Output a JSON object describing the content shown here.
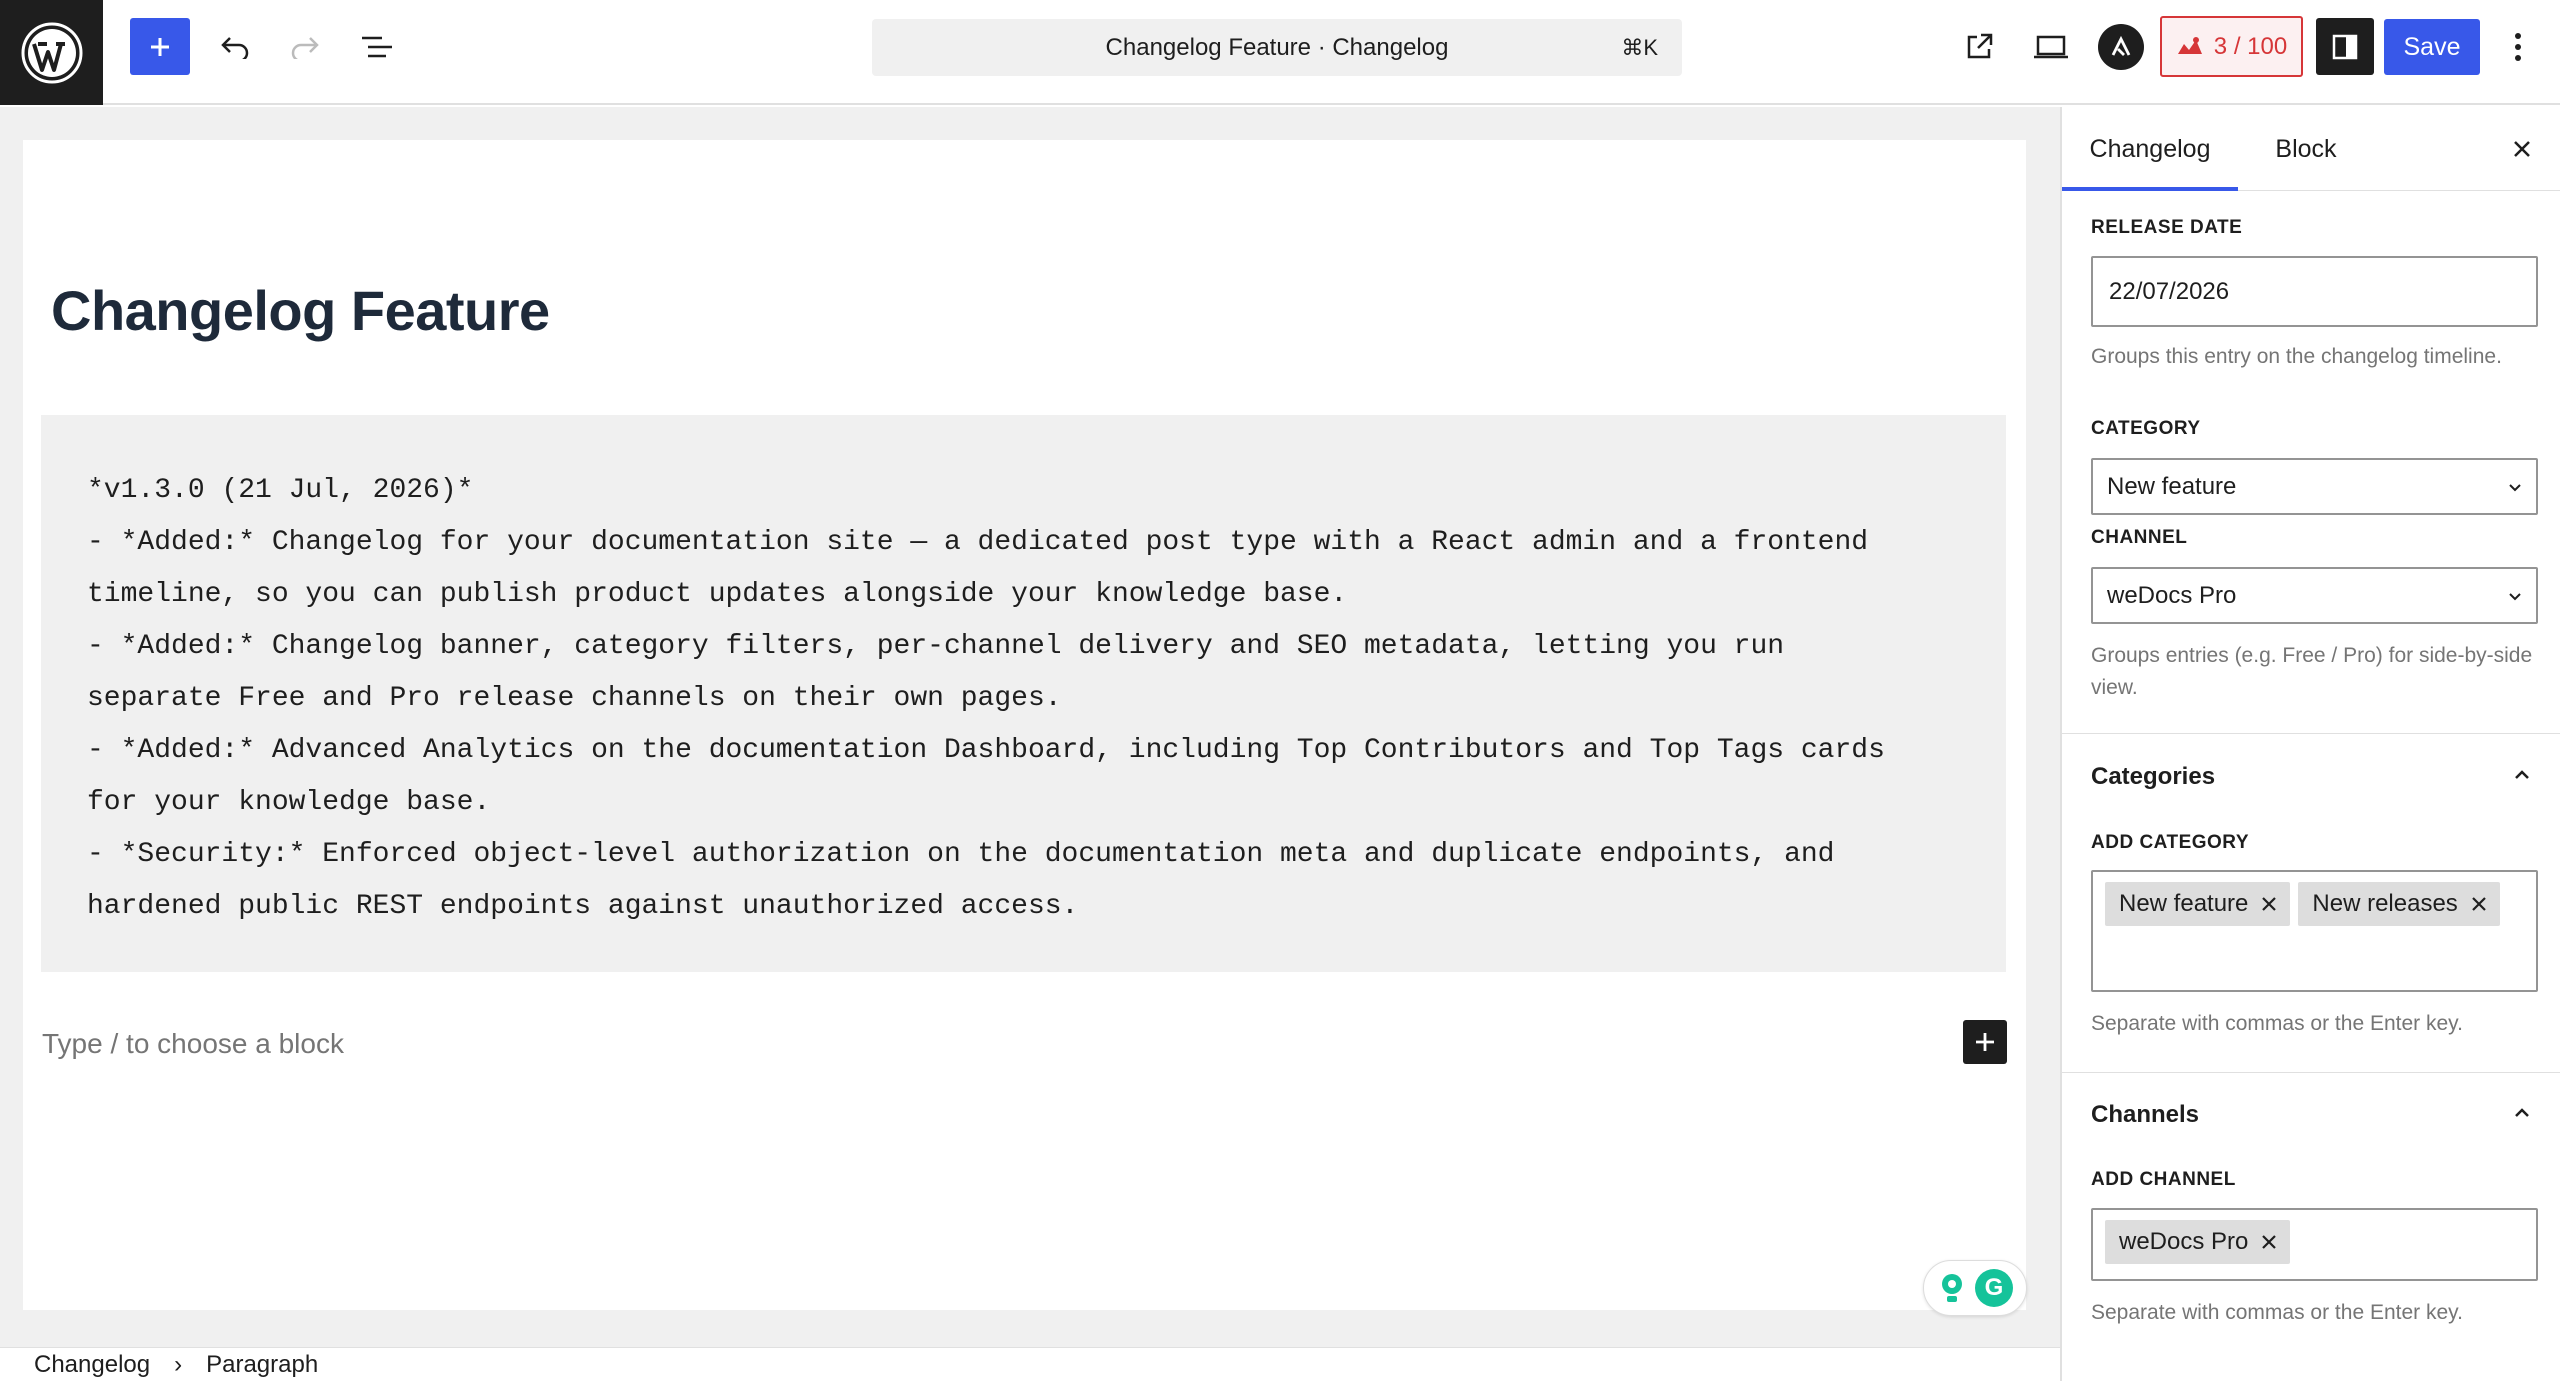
{
  "toolbar": {
    "document_title": "Changelog Feature · Changelog",
    "command_shortcut": "⌘K",
    "score_label": "3 / 100",
    "save_label": "Save"
  },
  "editor": {
    "post_title": "Changelog Feature",
    "code_lines": [
      "*v1.3.0 (21 Jul, 2026)*",
      "- *Added:* Changelog for your documentation site — a dedicated post type with a React admin and a frontend",
      "timeline, so you can publish product updates alongside your knowledge base.",
      "- *Added:* Changelog banner, category filters, per-channel delivery and SEO metadata, letting you run",
      "separate Free and Pro release channels on their own pages.",
      "- *Added:* Advanced Analytics on the documentation Dashboard, including Top Contributors and Top Tags cards",
      "for your knowledge base.",
      "- *Security:* Enforced object-level authorization on the documentation meta and duplicate endpoints, and",
      "hardened public REST endpoints against unauthorized access."
    ],
    "placeholder": "Type / to choose a block"
  },
  "breadcrumb": {
    "items": [
      "Changelog",
      "Paragraph"
    ]
  },
  "sidebar": {
    "tabs": [
      "Changelog",
      "Block"
    ],
    "release_date": {
      "label": "RELEASE DATE",
      "value": "22/07/2026",
      "help": "Groups this entry on the changelog timeline."
    },
    "category": {
      "label": "CATEGORY",
      "value": "New feature"
    },
    "channel": {
      "label": "CHANNEL",
      "value": "weDocs Pro",
      "help": "Groups entries (e.g. Free / Pro) for side-by-side view."
    },
    "categories_panel": {
      "title": "Categories",
      "field_label": "ADD CATEGORY",
      "tokens": [
        "New feature",
        "New releases"
      ],
      "help": "Separate with commas or the Enter key."
    },
    "channels_panel": {
      "title": "Channels",
      "field_label": "ADD CHANNEL",
      "tokens": [
        "weDocs Pro"
      ],
      "help": "Separate with commas or the Enter key."
    }
  },
  "colors": {
    "accent": "#3858e9",
    "score_red": "#d63638",
    "dark": "#1e1e1e"
  },
  "icons": [
    "wordpress-logo-icon",
    "plus-icon",
    "undo-icon",
    "redo-icon",
    "list-view-icon",
    "external-link-icon",
    "device-preview-icon",
    "ai-assistant-icon",
    "seo-score-icon",
    "sidebar-toggle-icon",
    "more-vertical-icon",
    "close-icon",
    "chevron-down-icon",
    "chevron-up-icon",
    "remove-token-icon",
    "grammarly-icon"
  ]
}
